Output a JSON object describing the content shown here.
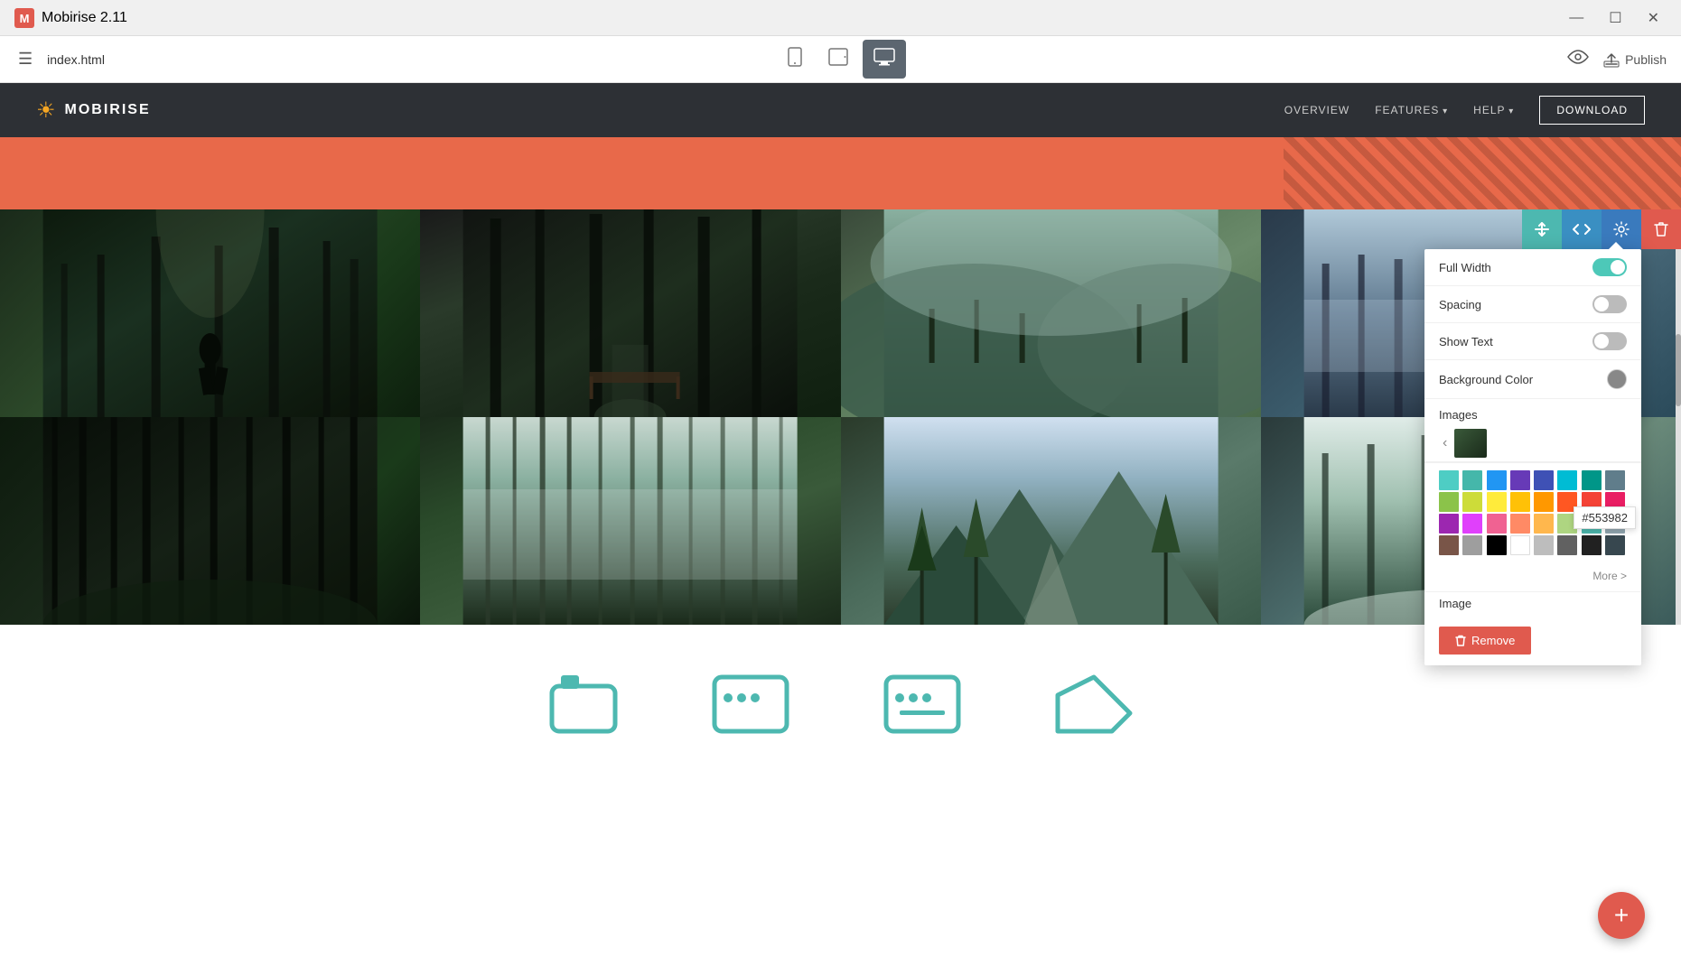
{
  "app": {
    "name": "Mobirise 2.11",
    "logo": "M"
  },
  "titlebar": {
    "title": "Mobirise 2.11",
    "controls": {
      "minimize": "—",
      "maximize": "☐",
      "close": "✕"
    }
  },
  "toolbar": {
    "filename": "index.html",
    "devices": [
      {
        "id": "mobile",
        "label": "Mobile"
      },
      {
        "id": "tablet",
        "label": "Tablet"
      },
      {
        "id": "desktop",
        "label": "Desktop",
        "active": true
      }
    ],
    "preview_label": "Preview",
    "publish_label": "Publish"
  },
  "site_navbar": {
    "brand": "MOBIRISE",
    "links": [
      {
        "label": "OVERVIEW",
        "has_arrow": false
      },
      {
        "label": "FEATURES",
        "has_arrow": true
      },
      {
        "label": "HELP",
        "has_arrow": true
      }
    ],
    "download_btn": "DOWNLOAD"
  },
  "gallery": {
    "toolbar_buttons": [
      {
        "id": "arrows",
        "icon": "⇅"
      },
      {
        "id": "code",
        "icon": "</>"
      },
      {
        "id": "settings",
        "icon": "⚙"
      },
      {
        "id": "delete",
        "icon": "🗑"
      }
    ]
  },
  "settings_panel": {
    "full_width": {
      "label": "Full Width",
      "value": true
    },
    "spacing": {
      "label": "Spacing",
      "value": false
    },
    "show_text": {
      "label": "Show Text",
      "value": false
    },
    "background_color": {
      "label": "Background Color"
    },
    "images_label": "Images",
    "image_label": "Image",
    "color_hex": "#553982",
    "more_link": "More >",
    "remove_btn": "Remove",
    "colors": [
      "#4ecdc4",
      "#45b7aa",
      "#2196f3",
      "#673ab7",
      "#3f51b5",
      "#00bcd4",
      "#009688",
      "#607d8b",
      "#8bc34a",
      "#cddc39",
      "#ffeb3b",
      "#ffc107",
      "#ff9800",
      "#ff5722",
      "#f44336",
      "#e91e63",
      "#9c27b0",
      "#e040fb",
      "#f06292",
      "#ff8a65",
      "#ffb74d",
      "#aed581",
      "#4db6ac",
      "#90a4ae",
      "#795548",
      "#9e9e9e",
      "#000000",
      "#fff",
      "#bdbdbd",
      "#616161",
      "#212121",
      "#37474f"
    ]
  },
  "fab": {
    "icon": "+"
  },
  "icons": {
    "hamburger": "☰",
    "eye": "👁",
    "upload": "⬆",
    "chevron_left": "‹",
    "trash": "🗑"
  }
}
